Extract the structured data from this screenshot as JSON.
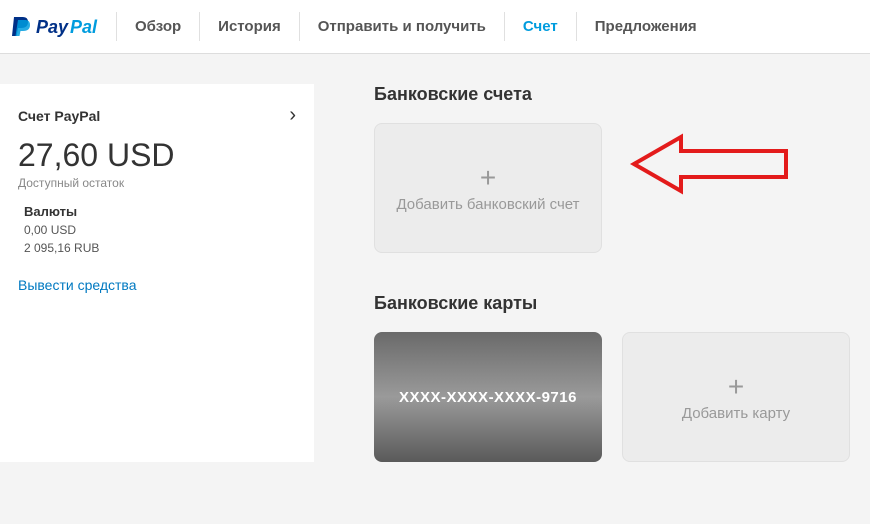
{
  "brand": "PayPal",
  "nav": {
    "items": [
      {
        "label": "Обзор",
        "active": false
      },
      {
        "label": "История",
        "active": false
      },
      {
        "label": "Отправить и получить",
        "active": false
      },
      {
        "label": "Счет",
        "active": true
      },
      {
        "label": "Предложения",
        "active": false
      }
    ]
  },
  "sidebar": {
    "account_title": "Счет PayPal",
    "balance_value": "27,60 USD",
    "balance_sub": "Доступный остаток",
    "currencies_title": "Валюты",
    "currencies": [
      "0,00 USD",
      "2 095,16 RUB"
    ],
    "withdraw": "Вывести средства"
  },
  "bank_accounts": {
    "title": "Банковские счета",
    "add_label": "Добавить банковский счет"
  },
  "bank_cards": {
    "title": "Банковские карты",
    "card_number": "XXXX-XXXX-XXXX-9716",
    "add_label": "Добавить карту"
  }
}
